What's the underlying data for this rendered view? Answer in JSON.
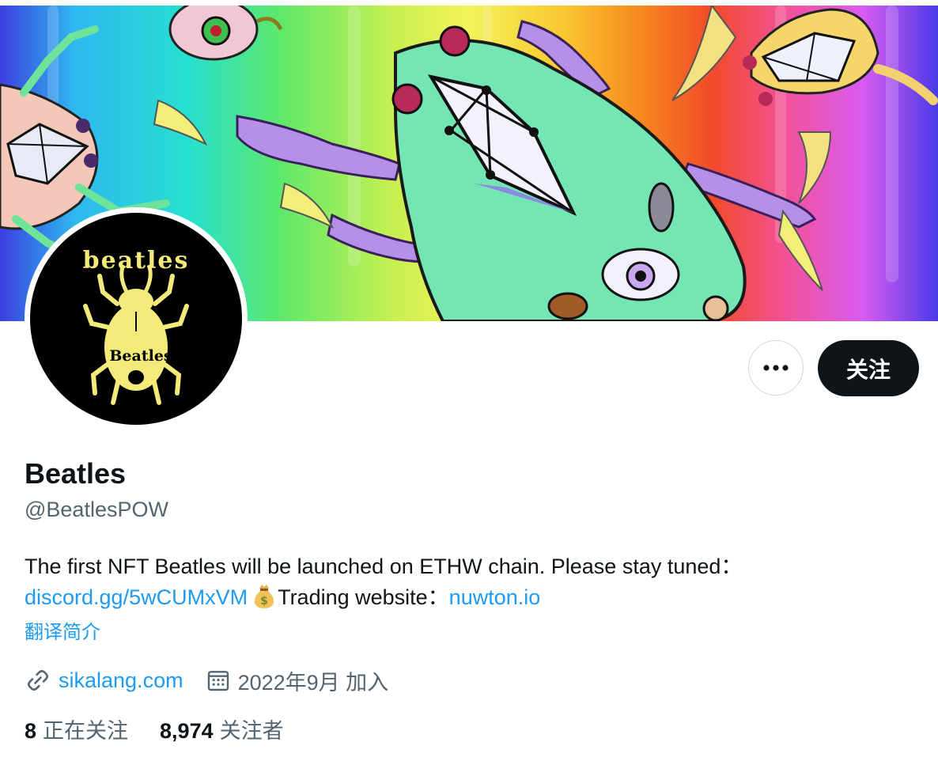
{
  "profile": {
    "display_name": "Beatles",
    "handle": "@BeatlesPOW",
    "bio_text": "The first NFT Beatles will be launched on ETHW chain. Please stay tuned：",
    "bio_link_discord": "discord.gg/5wCUMxVM",
    "bio_trading_label": "Trading website：",
    "bio_link_trading": "nuwton.io",
    "translate_label": "翻译简介",
    "website": "sikalang.com",
    "joined": "2022年9月 加入",
    "following_count": "8",
    "following_label": "正在关注",
    "followers_count": "8,974",
    "followers_label": "关注者",
    "avatar_text_top": "beatles",
    "avatar_text_body": "Beatles"
  },
  "actions": {
    "follow_label": "关注",
    "more_icon": "more-horizontal-icon"
  },
  "colors": {
    "link": "#1d9bf0",
    "primary_text": "#0f1419",
    "secondary_text": "#536471",
    "follow_bg": "#0f1419",
    "avatar_yellow": "#f4ea7a"
  }
}
